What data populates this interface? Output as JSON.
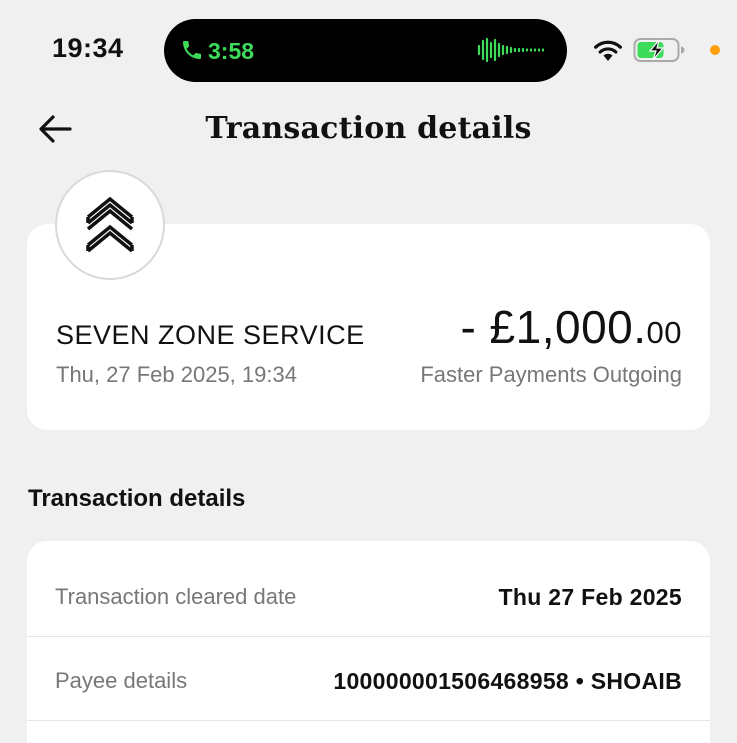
{
  "status_bar": {
    "time": "19:34",
    "call_time": "3:58",
    "icons": [
      "phone-icon",
      "waveform-icon",
      "wifi-icon",
      "battery-charging-icon",
      "privacy-dot"
    ],
    "colors": {
      "call_green": "#3ddb5a",
      "privacy_orange": "#ff9f0a"
    }
  },
  "header": {
    "title": "Transaction details",
    "back_icon": "back-arrow-icon"
  },
  "summary": {
    "merchant_icon": "double-chevron-up-icon",
    "merchant_name": "SEVEN ZONE SERVICE",
    "datetime": "Thu, 27 Feb 2025, 19:34",
    "amount_main": "- £1,000.",
    "amount_pence": "00",
    "payment_type": "Faster Payments Outgoing"
  },
  "details": {
    "heading": "Transaction details",
    "rows": [
      {
        "label": "Transaction cleared date",
        "value": "Thu 27 Feb 2025"
      },
      {
        "label": "Payee details",
        "value": "100000001506468958 • SHOAIB"
      }
    ]
  }
}
